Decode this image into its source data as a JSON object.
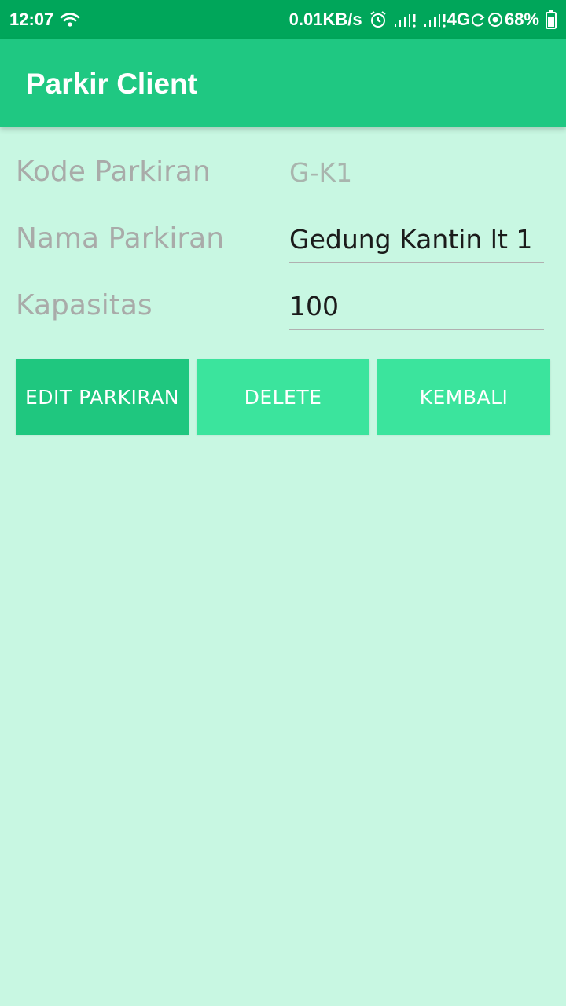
{
  "status_bar": {
    "time": "12:07",
    "net_speed": "0.01KB/s",
    "network": "4G",
    "battery": "68%",
    "icons": [
      "wifi-icon",
      "alarm-icon",
      "signal-icon",
      "signal-icon",
      "sync-icon",
      "location-icon",
      "battery-icon"
    ]
  },
  "app_bar": {
    "title": "Parkir Client"
  },
  "form": {
    "kode": {
      "label": "Kode Parkiran",
      "value": "G-K1"
    },
    "nama": {
      "label": "Nama Parkiran",
      "value": "Gedung Kantin lt 1"
    },
    "kapasitas": {
      "label": "Kapasitas",
      "value": "100"
    }
  },
  "buttons": {
    "edit": "EDIT PARKIRAN",
    "delete": "DELETE",
    "back": "KEMBALI"
  },
  "colors": {
    "status_bar": "#00a65a",
    "app_bar": "#1fc882",
    "background": "#c8f7e2",
    "button_primary": "#1fc77f",
    "button_secondary": "#3be49d"
  }
}
